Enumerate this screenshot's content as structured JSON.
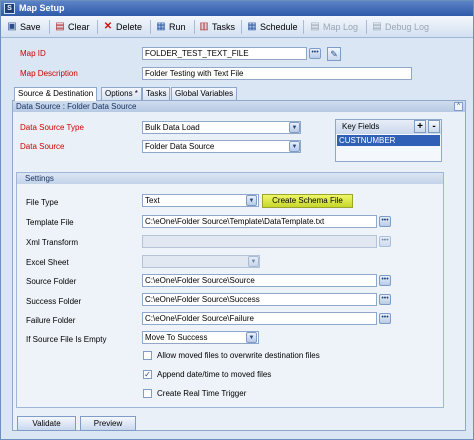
{
  "window": {
    "title": "Map Setup",
    "app_icon": "S"
  },
  "toolbar": {
    "save": "Save",
    "clear": "Clear",
    "delete": "Delete",
    "run": "Run",
    "tasks": "Tasks",
    "schedule": "Schedule",
    "map_log": "Map Log",
    "debug_log": "Debug Log"
  },
  "form": {
    "map_id_label": "Map ID",
    "map_id_value": "FOLDER_TEST_TEXT_FILE",
    "map_desc_label": "Map Description",
    "map_desc_value": "Folder Testing with Text File"
  },
  "tabs": [
    {
      "label": "Source & Destination",
      "active": true
    },
    {
      "label": "Options *"
    },
    {
      "label": "Tasks"
    },
    {
      "label": "Global Variables"
    }
  ],
  "data_source": {
    "header": "Data Source : Folder Data Source",
    "type_label": "Data Source Type",
    "type_value": "Bulk Data Load",
    "source_label": "Data Source",
    "source_value": "Folder Data Source"
  },
  "key_fields": {
    "header": "Key Fields",
    "add": "+",
    "remove": "-",
    "rows": [
      "CUSTNUMBER"
    ]
  },
  "settings": {
    "title": "Settings",
    "file_type_label": "File Type",
    "file_type_value": "Text",
    "create_schema_button": "Create Schema File",
    "template_label": "Template File",
    "template_value": "C:\\eOne\\Folder Source\\Template\\DataTemplate.txt",
    "xml_label": "Xml Transform",
    "xml_value": "",
    "excel_label": "Excel Sheet",
    "excel_value": "",
    "source_folder_label": "Source Folder",
    "source_folder_value": "C:\\eOne\\Folder Source\\Source",
    "success_folder_label": "Success Folder",
    "success_folder_value": "C:\\eOne\\Folder Source\\Success",
    "failure_folder_label": "Failure Folder",
    "failure_folder_value": "C:\\eOne\\Folder Source\\Failure",
    "empty_label": "If Source File Is Empty",
    "empty_value": "Move To Success",
    "chk_overwrite_label": "Allow moved files to overwrite destination files",
    "chk_overwrite": false,
    "chk_append_label": "Append date/time to moved files",
    "chk_append": true,
    "chk_trigger_label": "Create Real Time Trigger",
    "chk_trigger": false
  },
  "footer": {
    "validate": "Validate",
    "preview": "Preview"
  },
  "glyphs": {
    "dots": "•••",
    "check": "✓",
    "dd": "▼",
    "collapse": "^"
  }
}
